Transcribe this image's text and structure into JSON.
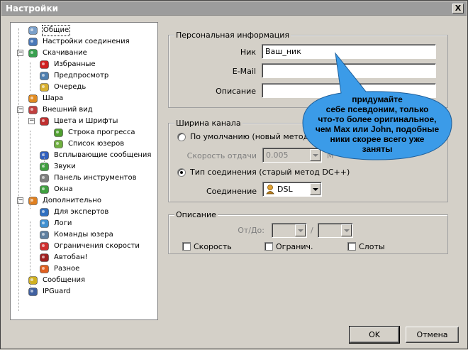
{
  "window": {
    "title": "Настройки",
    "close_label": "X"
  },
  "tree": [
    {
      "label": "Общие",
      "icon": "general-icon",
      "level": 1,
      "selected": true
    },
    {
      "label": "Настройки соединения",
      "icon": "connection-icon",
      "level": 1
    },
    {
      "label": "Скачивание",
      "icon": "download-icon",
      "level": 1,
      "expanded": true
    },
    {
      "label": "Избранные",
      "icon": "heart-icon",
      "level": 2
    },
    {
      "label": "Предпросмотр",
      "icon": "preview-icon",
      "level": 2
    },
    {
      "label": "Очередь",
      "icon": "queue-icon",
      "level": 2
    },
    {
      "label": "Шара",
      "icon": "share-icon",
      "level": 1
    },
    {
      "label": "Внешний вид",
      "icon": "appearance-icon",
      "level": 1,
      "expanded": true
    },
    {
      "label": "Цвета и Шрифты",
      "icon": "colors-icon",
      "level": 2,
      "expanded": true
    },
    {
      "label": "Строка прогресса",
      "icon": "progress-icon",
      "level": 3
    },
    {
      "label": "Список юзеров",
      "icon": "userlist-icon",
      "level": 3
    },
    {
      "label": "Всплывающие сообщения",
      "icon": "popup-icon",
      "level": 2
    },
    {
      "label": "Звуки",
      "icon": "sound-icon",
      "level": 2
    },
    {
      "label": "Панель инструментов",
      "icon": "toolbar-icon",
      "level": 2
    },
    {
      "label": "Окна",
      "icon": "windows-icon",
      "level": 2
    },
    {
      "label": "Дополнительно",
      "icon": "advanced-icon",
      "level": 1,
      "expanded": true
    },
    {
      "label": "Для экспертов",
      "icon": "expert-icon",
      "level": 2
    },
    {
      "label": "Логи",
      "icon": "logs-icon",
      "level": 2
    },
    {
      "label": "Команды юзера",
      "icon": "usercmd-icon",
      "level": 2
    },
    {
      "label": "Ограничения скорости",
      "icon": "speedlimit-icon",
      "level": 2
    },
    {
      "label": "Автобан!",
      "icon": "autoban-icon",
      "level": 2
    },
    {
      "label": "Разное",
      "icon": "misc-icon",
      "level": 2
    },
    {
      "label": "Сообщения",
      "icon": "messages-icon",
      "level": 1
    },
    {
      "label": "IPGuard",
      "icon": "ipguard-icon",
      "level": 1
    }
  ],
  "personal": {
    "title": "Персональная информация",
    "nick_label": "Ник",
    "nick_value": "Ваш_ник",
    "email_label": "E-Mail",
    "email_value": "",
    "desc_label": "Описание",
    "desc_value": ""
  },
  "bandwidth": {
    "title": "Ширина канала",
    "default_radio": "По умолчанию (новый метод DC",
    "upload_label": "Скорость отдачи",
    "upload_value": "0.005",
    "upload_unit": "M",
    "conn_type_radio": "Тип соединения (старый метод DC++)",
    "conn_label": "Соединение",
    "conn_value": "DSL"
  },
  "description": {
    "title": "Описание",
    "fromto_label": "От/До:",
    "slash": "/",
    "speed_label": "Скорость",
    "limit_label": "Огранич.",
    "slots_label": "Слоты"
  },
  "tooltip": {
    "lines": [
      "придумайте",
      "себе псевдоним, только",
      "что-то более оригинальное,",
      "чем Max или John, подобные",
      "ники скорее всего уже",
      "заняты"
    ],
    "fill": "#3b9be8"
  },
  "buttons": {
    "ok": "OK",
    "cancel": "Отмена"
  }
}
